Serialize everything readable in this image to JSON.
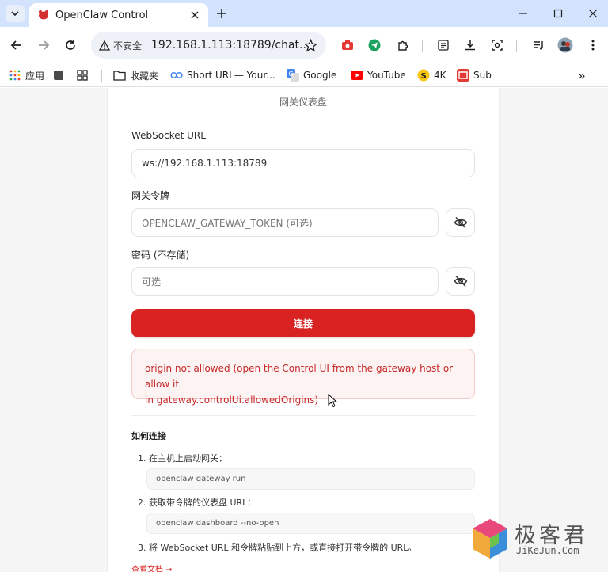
{
  "browser": {
    "tab": {
      "title": "OpenClaw Control"
    },
    "omnibox": {
      "security_label": "不安全",
      "url": "192.168.1.113:18789/chat..."
    },
    "bookmarks": [
      {
        "label": "应用",
        "icon": "apps-grid-icon"
      },
      {
        "label": "",
        "icon": "square-icon"
      },
      {
        "label": "",
        "icon": "grid-icon"
      },
      {
        "label": "收藏夹",
        "icon": "folder-icon"
      },
      {
        "label": "Short URL— Your...",
        "icon": "link-icon"
      },
      {
        "label": "Google",
        "icon": "google-translate-icon"
      },
      {
        "label": "YouTube",
        "icon": "youtube-icon"
      },
      {
        "label": "4K",
        "icon": "coin-icon"
      },
      {
        "label": "Sub",
        "icon": "sub-icon"
      }
    ],
    "bookmarks_overflow": "»"
  },
  "page": {
    "subtitle": "网关仪表盘",
    "websocket": {
      "label": "WebSocket URL",
      "value": "ws://192.168.1.113:18789"
    },
    "token": {
      "label": "网关令牌",
      "placeholder": "OPENCLAW_GATEWAY_TOKEN (可选)"
    },
    "password": {
      "label": "密码 (不存储)",
      "placeholder": "可选"
    },
    "connect_label": "连接",
    "error": {
      "line1": "origin not allowed (open the Control UI from the gateway host or allow it",
      "line2": "in gateway.controlUi.allowedOrigins)"
    },
    "howto": {
      "title": "如何连接",
      "step1": "1. 在主机上启动网关：",
      "code1": "openclaw gateway run",
      "step2": "2. 获取带令牌的仪表盘 URL：",
      "code2": "openclaw dashboard --no-open",
      "step3": "3. 将 WebSocket URL 和令牌粘贴到上方，或直接打开带令牌的 URL。"
    },
    "doc_link": "查看文档 →"
  },
  "watermark": {
    "text": "极客君",
    "sub": "JiKeJun.Com"
  },
  "colors": {
    "accent": "#d92222",
    "error_bg": "#fdf3f3",
    "error_text": "#c62828",
    "tabstrip": "#d3e3fd"
  }
}
